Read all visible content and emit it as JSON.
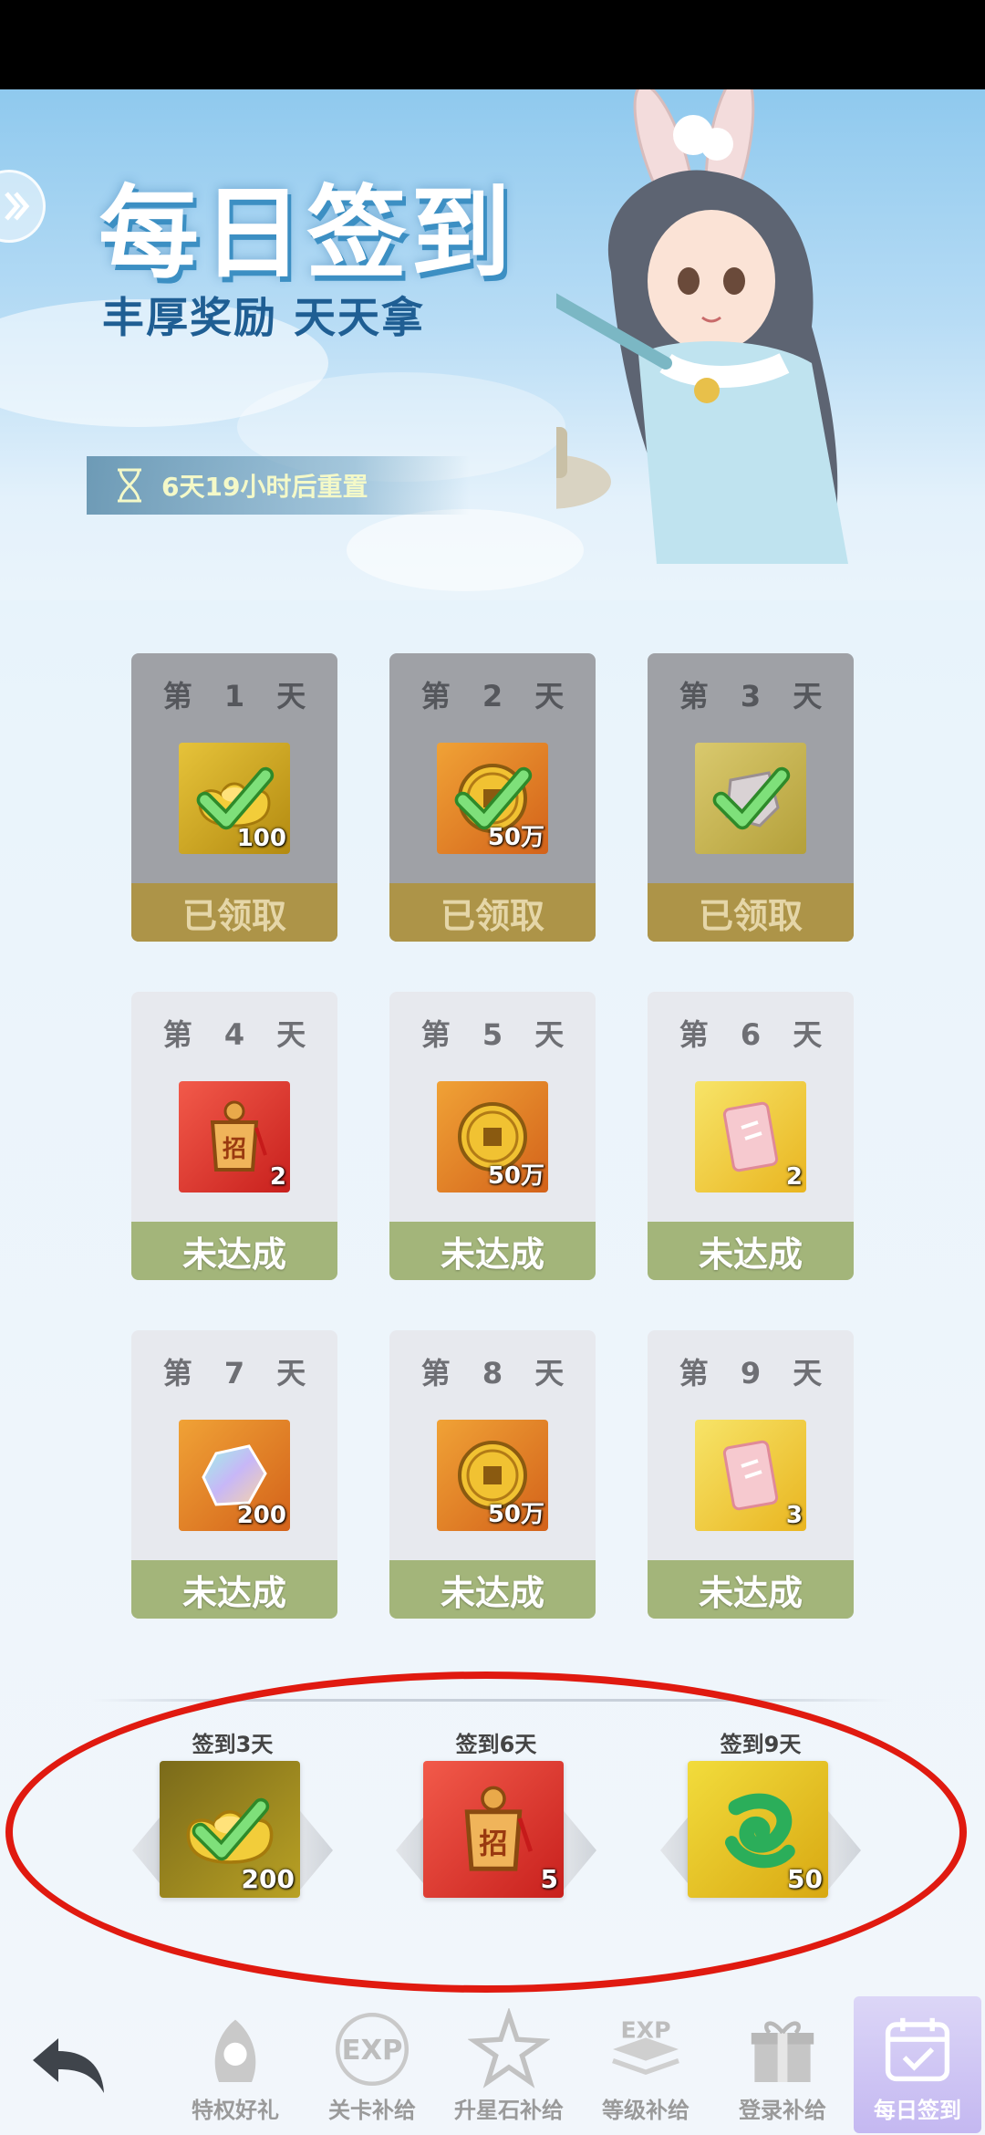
{
  "banner": {
    "title": "每日签到",
    "subtitle": "丰厚奖励 天天拿",
    "reset_text": "6天19小时后重置"
  },
  "days": [
    {
      "label": "第 1 天",
      "qty": "100",
      "status": "已领取",
      "state": "claimed",
      "item": "gold-ingot-icon"
    },
    {
      "label": "第 2 天",
      "qty": "50万",
      "status": "已领取",
      "state": "claimed",
      "item": "coin-icon"
    },
    {
      "label": "第 3 天",
      "qty": "",
      "status": "已领取",
      "state": "claimed",
      "item": "stone-icon"
    },
    {
      "label": "第 4 天",
      "qty": "2",
      "status": "未达成",
      "state": "pending",
      "item": "recruit-token-icon"
    },
    {
      "label": "第 5 天",
      "qty": "50万",
      "status": "未达成",
      "state": "pending",
      "item": "coin-icon"
    },
    {
      "label": "第 6 天",
      "qty": "2",
      "status": "未达成",
      "state": "pending",
      "item": "ticket-icon"
    },
    {
      "label": "第 7 天",
      "qty": "200",
      "status": "未达成",
      "state": "pending",
      "item": "crystal-icon"
    },
    {
      "label": "第 8 天",
      "qty": "50万",
      "status": "未达成",
      "state": "pending",
      "item": "coin-icon"
    },
    {
      "label": "第 9 天",
      "qty": "3",
      "status": "未达成",
      "state": "pending",
      "item": "ticket-icon"
    }
  ],
  "milestones": [
    {
      "label": "签到3天",
      "qty": "200",
      "item": "gold-ingot-icon",
      "claimed": true
    },
    {
      "label": "签到6天",
      "qty": "5",
      "item": "recruit-token-icon",
      "claimed": false
    },
    {
      "label": "签到9天",
      "qty": "50",
      "item": "jade-dragon-icon",
      "claimed": false
    }
  ],
  "nav": [
    {
      "label": "特权好礼",
      "icon": "privilege-gift-icon",
      "active": false
    },
    {
      "label": "关卡补给",
      "icon": "exp-stage-icon",
      "active": false
    },
    {
      "label": "升星石补给",
      "icon": "star-stone-icon",
      "active": false
    },
    {
      "label": "等级补给",
      "icon": "exp-level-icon",
      "active": false
    },
    {
      "label": "登录补给",
      "icon": "gift-box-icon",
      "active": false
    },
    {
      "label": "每日签到",
      "icon": "calendar-check-icon",
      "active": true
    }
  ],
  "colors": {
    "claimed_card": "#9fa1a6",
    "claimed_status": "#ad9448",
    "pending_card": "#e7e9ee",
    "pending_status": "#a3b57a",
    "annotation_red": "#e01a10"
  }
}
